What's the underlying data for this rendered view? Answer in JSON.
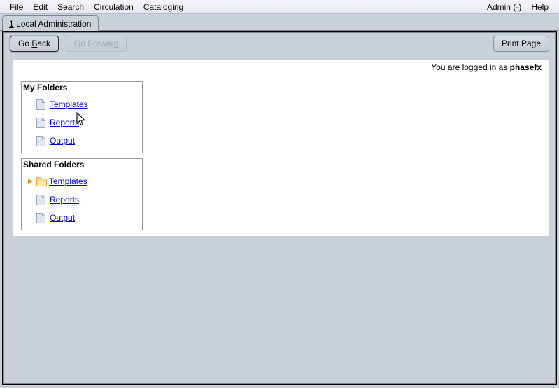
{
  "menubar": {
    "items": [
      {
        "label": "File",
        "accel_index": 0
      },
      {
        "label": "Edit",
        "accel_index": 0
      },
      {
        "label": "Search",
        "accel_index": 4
      },
      {
        "label": "Circulation",
        "accel_index": 0
      },
      {
        "label": "Cataloging",
        "accel_index": 7
      }
    ],
    "right_items": [
      {
        "label": "Admin (-)",
        "accel_index": 7
      },
      {
        "label": "Help",
        "accel_index": 0
      }
    ]
  },
  "tabs": [
    {
      "number": "1",
      "label": "Local Administration",
      "active": true
    }
  ],
  "toolbar": {
    "go_back_label": "Go Back",
    "go_back_accel": "B",
    "go_forward_label": "Go Forward",
    "go_forward_accel": "d",
    "go_forward_disabled": true,
    "print_page_label": "Print Page"
  },
  "page": {
    "login_prefix": "You are logged in as ",
    "login_user": "phasefx"
  },
  "panels": [
    {
      "id": "my-folders",
      "title": "My Folders",
      "items": [
        {
          "label": "Templates",
          "icon": "document-icon",
          "twisty": false
        },
        {
          "label": "Reports",
          "icon": "document-icon",
          "twisty": false
        },
        {
          "label": "Output",
          "icon": "document-icon",
          "twisty": false
        }
      ]
    },
    {
      "id": "shared-folders",
      "title": "Shared Folders",
      "items": [
        {
          "label": "Templates",
          "icon": "folder-icon",
          "twisty": true
        },
        {
          "label": "Reports",
          "icon": "document-icon",
          "twisty": false
        },
        {
          "label": "Output",
          "icon": "document-icon",
          "twisty": false
        }
      ]
    }
  ],
  "colors": {
    "link": "#0000cc",
    "chrome": "#c9d0da",
    "menubar_top": "#f4f6f9",
    "folder_fill": "#ffe9a8",
    "folder_border": "#d9a441",
    "twisty": "#c79b18",
    "doc_fill": "#dfe6f0",
    "doc_border": "#9aa7bb"
  }
}
